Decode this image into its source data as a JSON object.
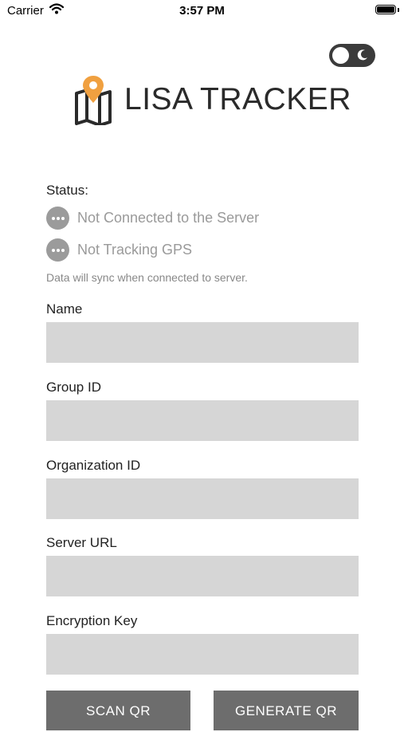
{
  "status_bar": {
    "carrier": "Carrier",
    "time": "3:57 PM"
  },
  "header": {
    "title": "LISA TRACKER",
    "logo_icon": "map-pin-icon",
    "theme_toggle_icon": "moon-icon"
  },
  "status": {
    "label": "Status:",
    "items": [
      {
        "text": "Not Connected to the Server",
        "icon": "ellipsis-icon"
      },
      {
        "text": "Not Tracking GPS",
        "icon": "ellipsis-icon"
      }
    ],
    "sync_note": "Data will sync when connected to server."
  },
  "form": {
    "fields": [
      {
        "label": "Name",
        "value": ""
      },
      {
        "label": "Group ID",
        "value": ""
      },
      {
        "label": "Organization ID",
        "value": ""
      },
      {
        "label": "Server URL",
        "value": ""
      },
      {
        "label": "Encryption Key",
        "value": ""
      }
    ]
  },
  "actions": {
    "scan_qr": "SCAN QR",
    "generate_qr": "GENERATE QR"
  },
  "colors": {
    "accent_orange": "#f0a040",
    "button_gray": "#6d6d6d",
    "input_gray": "#d6d6d6",
    "status_gray": "#9b9b9b"
  }
}
